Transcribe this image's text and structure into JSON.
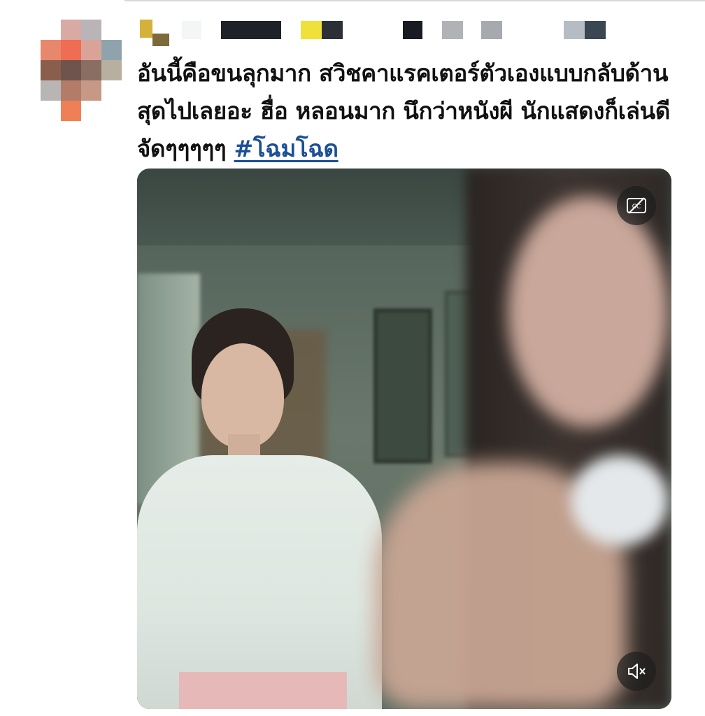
{
  "tweet": {
    "text": "อันนี้คือขนลุกมาก สวิชคาแรคเตอร์ตัวเองแบบกลับด้านสุดไปเลยอะ ฮื่อ หลอนมาก นึกว่าหนังผี นักแสดงก็เล่นดีจัดๆๆๆๆๆ",
    "hashtag": "#โฉมโฉด"
  },
  "media": {
    "cc_icon": "closed-captions-off-icon",
    "mute_icon": "volume-muted-icon"
  },
  "colors": {
    "hashtag": "#1b4f96",
    "text": "#111111",
    "media_button_bg": "rgba(30,30,30,0.72)"
  }
}
